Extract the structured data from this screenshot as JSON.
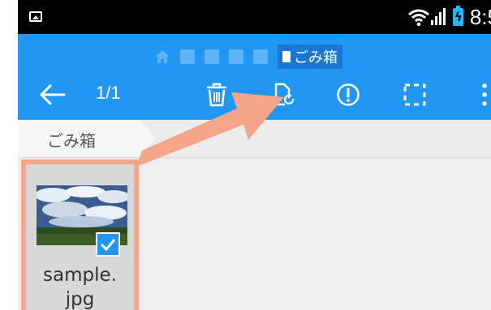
{
  "status_bar": {
    "time": "8:5",
    "icons": [
      "gallery-icon",
      "wifi-icon",
      "signal-icon",
      "battery-charging-icon"
    ]
  },
  "breadcrumb": {
    "path_icons": [
      "home-icon",
      "device-icon",
      "message-icon",
      "printer-icon",
      "monitor-icon"
    ],
    "current": "ごみ箱"
  },
  "toolbar": {
    "selection_count": "1/1",
    "actions": [
      "back-arrow-icon",
      "delete-icon",
      "restore-icon",
      "info-icon",
      "select-all-icon",
      "more-icon"
    ]
  },
  "tab": {
    "label": "ごみ箱"
  },
  "files": [
    {
      "name": "sample.\njpg",
      "selected": true
    }
  ],
  "colors": {
    "primary": "#2196f3",
    "highlight": "#f4a58a",
    "status_bar": "#000000"
  }
}
